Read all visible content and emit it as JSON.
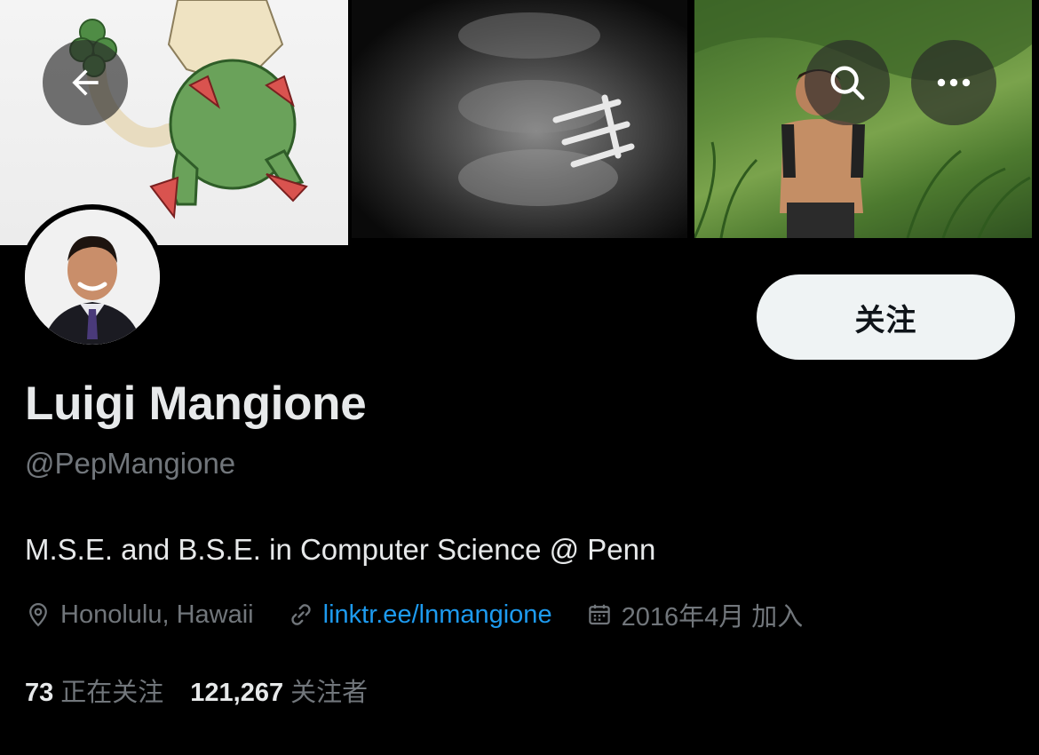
{
  "header": {
    "back_icon": "arrow-left-icon",
    "search_icon": "search-icon",
    "more_icon": "more-horizontal-icon"
  },
  "profile": {
    "name": "Luigi Mangione",
    "handle": "@PepMangione",
    "bio": "M.S.E. and B.S.E. in Computer Science @ Penn",
    "follow_label": "关注",
    "location": "Honolulu, Hawaii",
    "link": "linktr.ee/lnmangione",
    "joined": "2016年4月 加入"
  },
  "stats": {
    "following_count": "73",
    "following_label": "正在关注",
    "followers_count": "121,267",
    "followers_label": "关注者"
  },
  "colors": {
    "background": "#000000",
    "text_primary": "#e7e9ea",
    "text_secondary": "#71767b",
    "link": "#1d9bf0",
    "follow_button_bg": "#eff3f4"
  }
}
